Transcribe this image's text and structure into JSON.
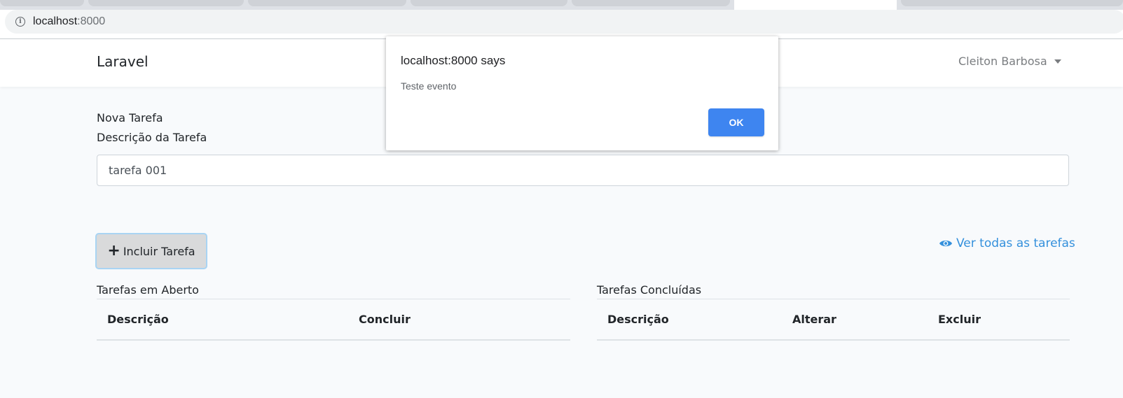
{
  "browser": {
    "url_host": "localhost",
    "url_port": ":8000"
  },
  "navbar": {
    "brand": "Laravel",
    "user_name": "Cleiton Barbosa"
  },
  "form": {
    "section_title": "Nova Tarefa",
    "description_label": "Descrição da Tarefa",
    "description_value": "tarefa 001",
    "add_button_label": "Incluir Tarefa",
    "view_all_label": "Ver todas as tarefas"
  },
  "open_tasks": {
    "caption": "Tarefas em Aberto",
    "columns": [
      "Descrição",
      "Concluir"
    ]
  },
  "done_tasks": {
    "caption": "Tarefas Concluídas",
    "columns": [
      "Descrição",
      "Alterar",
      "Excluir"
    ]
  },
  "dialog": {
    "title": "localhost:8000 says",
    "message": "Teste evento",
    "ok_label": "OK"
  },
  "colors": {
    "link": "#3490dc",
    "dialog_button": "#3e85f0",
    "page_background": "#f8fafc"
  }
}
